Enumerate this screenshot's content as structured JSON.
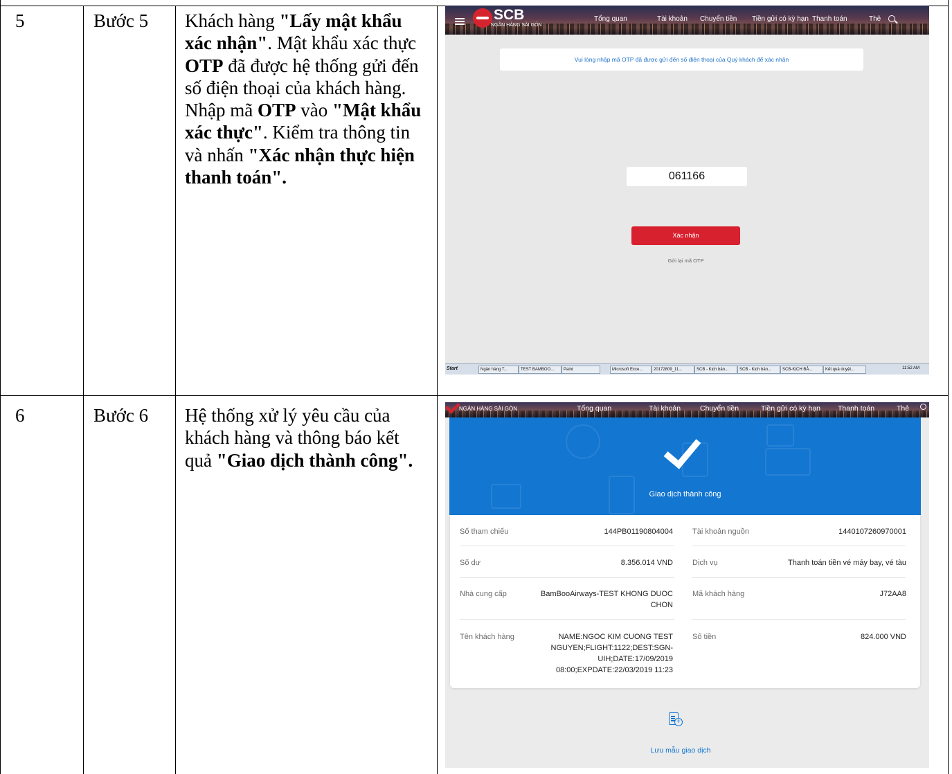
{
  "rows": [
    {
      "number": "5",
      "step": "Bước 5",
      "description": [
        {
          "text": "Khách hàng ",
          "bold": false
        },
        {
          "text": "\"Lấy mật khẩu xác nhận\"",
          "bold": true
        },
        {
          "text": ". Mật khẩu xác thực ",
          "bold": false
        },
        {
          "text": "OTP",
          "bold": true
        },
        {
          "text": " đã được hệ thống gửi đến số điện thoại của khách hàng. Nhập mã ",
          "bold": false
        },
        {
          "text": "OTP",
          "bold": true
        },
        {
          "text": " vào ",
          "bold": false
        },
        {
          "text": "\"Mật khẩu xác thực\"",
          "bold": true
        },
        {
          "text": ". Kiểm tra thông tin và nhấn ",
          "bold": false
        },
        {
          "text": "\"Xác nhận thực hiện thanh toán\".",
          "bold": true
        }
      ]
    },
    {
      "number": "6",
      "step": "Bước 6",
      "description": [
        {
          "text": "Hệ thống xử lý yêu cầu của khách hàng và thông báo kết quả ",
          "bold": false
        },
        {
          "text": "\"Giao dịch thành công\".",
          "bold": true
        }
      ]
    }
  ],
  "shot1": {
    "logo": "SCB",
    "logo_sub": "NGÂN HÀNG SÀI GÒN",
    "nav": [
      "Tổng quan",
      "Tài khoản",
      "Chuyển tiền",
      "Tiền gửi có kỳ hạn",
      "Thanh toán",
      "Thẻ"
    ],
    "notice": "Vui lòng nhập mã OTP đã được gửi đến số điện thoại của Quý khách để xác nhận",
    "otp_value": "061166",
    "confirm_button": "Xác nhận",
    "resend_link": "Gởi lại mã OTP",
    "taskbar": {
      "start": "Start",
      "tasks": [
        "Ngân hàng T...",
        "TEST BAMBOO...",
        "Paint",
        "Microsoft Exce...",
        "20172809_11...",
        "SCB - Kịch bản...",
        "SCB - Kịch bản...",
        "SCB-KỊCH BẢ...",
        "Kết quả duyệt..."
      ],
      "clock": "11:52 AM"
    }
  },
  "shot2": {
    "logo_sub": "NGÂN HÀNG SÀI GÒN",
    "nav": [
      "Tổng quan",
      "Tài khoản",
      "Chuyển tiền",
      "Tiền gửi có kỳ hạn",
      "Thanh toán",
      "Thẻ"
    ],
    "success_title": "Giao dịch thành công",
    "details": [
      {
        "label": "Số tham chiếu",
        "value": "144PB01190804004",
        "label2": "Tài khoản nguồn",
        "value2": "1440107260970001"
      },
      {
        "label": "Số dư",
        "value": "8.356.014 VND",
        "label2": "Dịch vụ",
        "value2": "Thanh toán tiền vé máy bay, vé tàu"
      },
      {
        "label": "Nhà cung cấp",
        "value_lines": [
          "BamBooAirways-TEST KHONG DUOC",
          "CHON"
        ],
        "label2": "Mã khách hàng",
        "value2": "J72AA8"
      },
      {
        "label": "Tên khách hàng",
        "value_lines": [
          "NAME:NGOC KIM CUONG TEST",
          "NGUYEN;FLIGHT:1122;DEST:SGN-",
          "UIH;DATE:17/09/2019",
          "08:00;EXPDATE:22/03/2019 11:23"
        ],
        "label2": "Số tiền",
        "value2": "824.000 VND"
      }
    ],
    "save_template": "Lưu mẫu giao dịch"
  }
}
